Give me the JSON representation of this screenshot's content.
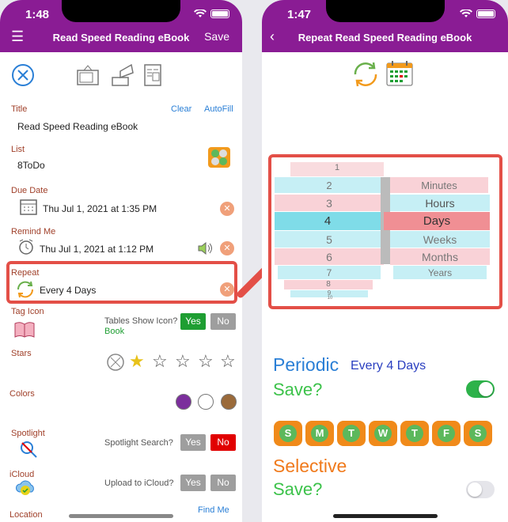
{
  "left": {
    "time": "1:48",
    "title": "Read Speed Reading eBook",
    "save": "Save",
    "title_label": "Title",
    "clear": "Clear",
    "autofill": "AutoFill",
    "title_value": "Read Speed Reading eBook",
    "list_label": "List",
    "list_value": "8ToDo",
    "due_label": "Due Date",
    "due_value": "Thu Jul 1, 2021 at 1:35 PM",
    "remind_label": "Remind Me",
    "remind_value": "Thu Jul 1, 2021 at 1:12 PM",
    "repeat_label": "Repeat",
    "repeat_value": "Every 4 Days",
    "tag_label": "Tag Icon",
    "tables_show": "Tables Show Icon?",
    "book": "Book",
    "yes": "Yes",
    "no": "No",
    "stars_label": "Stars",
    "colors_label": "Colors",
    "spotlight_label": "Spotlight",
    "spotlight_q": "Spotlight Search?",
    "icloud_label": "iCloud",
    "icloud_q": "Upload to iCloud?",
    "location_label": "Location",
    "find_me": "Find Me",
    "colors": [
      "#7b2e9c",
      "#ffffff",
      "#9a6a3a"
    ],
    "accent": "#8a1c94"
  },
  "right": {
    "time": "1:47",
    "title": "Repeat Read Speed Reading eBook",
    "numbers": [
      "1",
      "2",
      "3",
      "4",
      "5",
      "6",
      "7",
      "8",
      "9",
      "10"
    ],
    "units": [
      "Minutes",
      "Hours",
      "Days",
      "Weeks",
      "Months",
      "Years"
    ],
    "periodic": "Periodic",
    "every": "Every 4 Days",
    "save1": "Save?",
    "days": [
      "S",
      "M",
      "T",
      "W",
      "T",
      "F",
      "S"
    ],
    "selective": "Selective",
    "save2": "Save?"
  }
}
